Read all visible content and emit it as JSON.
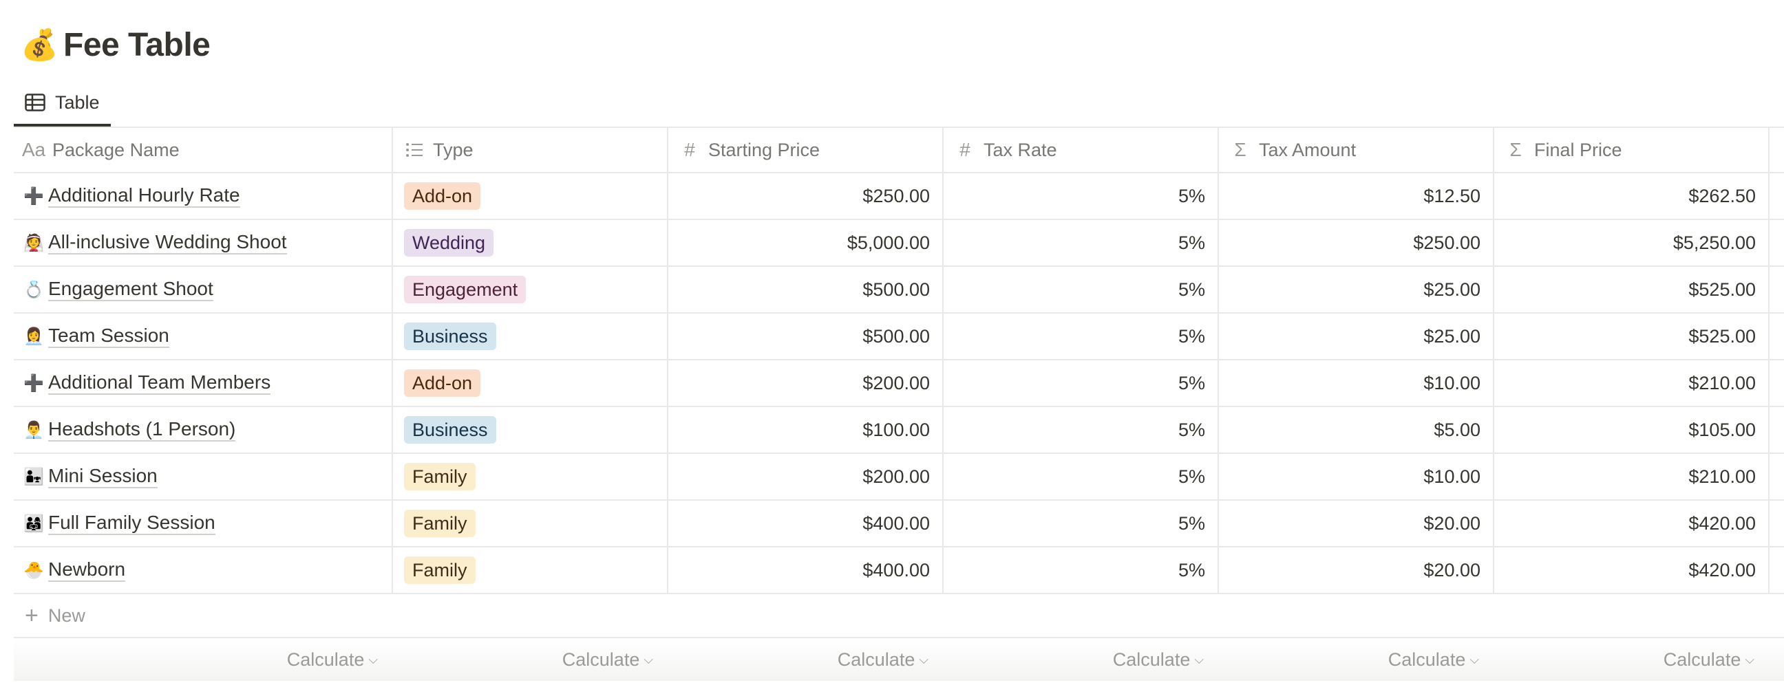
{
  "page": {
    "title_emoji": "💰",
    "title": "Fee Table"
  },
  "views": {
    "tabs": [
      {
        "label": "Table",
        "icon": "table-icon",
        "active": true
      }
    ]
  },
  "table": {
    "columns": [
      {
        "label": "Package Name",
        "icon": "text-property-icon"
      },
      {
        "label": "Type",
        "icon": "list-property-icon"
      },
      {
        "label": "Starting Price",
        "icon": "number-property-icon"
      },
      {
        "label": "Tax Rate",
        "icon": "number-property-icon"
      },
      {
        "label": "Tax Amount",
        "icon": "formula-property-icon"
      },
      {
        "label": "Final Price",
        "icon": "formula-property-icon"
      }
    ],
    "rows": [
      {
        "emoji": "➕",
        "name": "Additional Hourly Rate",
        "type": "Add-on",
        "starting_price": "$250.00",
        "tax_rate": "5%",
        "tax_amount": "$12.50",
        "final_price": "$262.50"
      },
      {
        "emoji": "👰",
        "name": "All-inclusive Wedding Shoot",
        "type": "Wedding",
        "starting_price": "$5,000.00",
        "tax_rate": "5%",
        "tax_amount": "$250.00",
        "final_price": "$5,250.00"
      },
      {
        "emoji": "💍",
        "name": "Engagement Shoot",
        "type": "Engagement",
        "starting_price": "$500.00",
        "tax_rate": "5%",
        "tax_amount": "$25.00",
        "final_price": "$525.00"
      },
      {
        "emoji": "👩‍💼",
        "name": "Team Session",
        "type": "Business",
        "starting_price": "$500.00",
        "tax_rate": "5%",
        "tax_amount": "$25.00",
        "final_price": "$525.00"
      },
      {
        "emoji": "➕",
        "name": "Additional Team Members",
        "type": "Add-on",
        "starting_price": "$200.00",
        "tax_rate": "5%",
        "tax_amount": "$10.00",
        "final_price": "$210.00"
      },
      {
        "emoji": "👨‍💼",
        "name": "Headshots (1 Person)",
        "type": "Business",
        "starting_price": "$100.00",
        "tax_rate": "5%",
        "tax_amount": "$5.00",
        "final_price": "$105.00"
      },
      {
        "emoji": "👨‍👧",
        "name": "Mini Session",
        "type": "Family",
        "starting_price": "$200.00",
        "tax_rate": "5%",
        "tax_amount": "$10.00",
        "final_price": "$210.00"
      },
      {
        "emoji": "👨‍👩‍👧",
        "name": "Full Family Session",
        "type": "Family",
        "starting_price": "$400.00",
        "tax_rate": "5%",
        "tax_amount": "$20.00",
        "final_price": "$420.00"
      },
      {
        "emoji": "🐣",
        "name": "Newborn",
        "type": "Family",
        "starting_price": "$400.00",
        "tax_rate": "5%",
        "tax_amount": "$20.00",
        "final_price": "$420.00"
      }
    ],
    "new_label": "New",
    "calculate_label": "Calculate"
  },
  "type_colors": {
    "Add-on": "#fadec9",
    "Wedding": "#e8deee",
    "Engagement": "#f5e0e9",
    "Business": "#d3e5ef",
    "Family": "#fbeecc"
  }
}
